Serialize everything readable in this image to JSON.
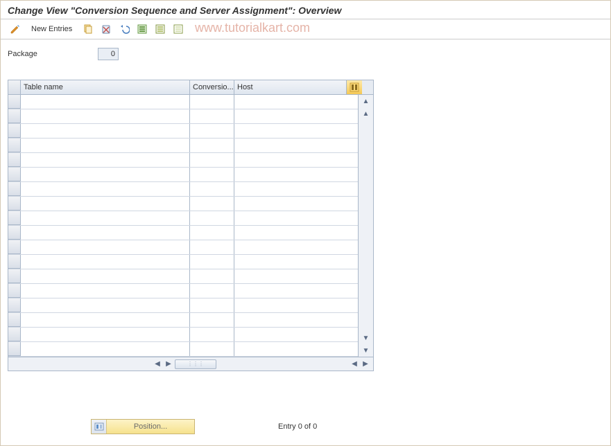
{
  "title": "Change View \"Conversion Sequence and Server Assignment\": Overview",
  "toolbar": {
    "new_entries": "New Entries"
  },
  "watermark": "www.tutorialkart.com",
  "field": {
    "package_label": "Package",
    "package_value": "0"
  },
  "table": {
    "columns": {
      "table_name": "Table name",
      "conversion": "Conversio...",
      "host": "Host"
    },
    "row_count": 18
  },
  "footer": {
    "position_label": "Position...",
    "entry_status": "Entry 0 of 0"
  }
}
